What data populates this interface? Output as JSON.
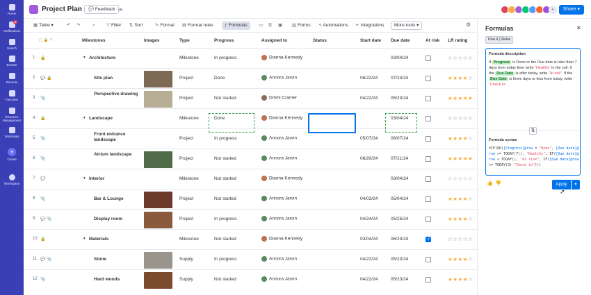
{
  "rail": [
    {
      "label": "Home",
      "icon": "home-icon"
    },
    {
      "label": "Notifications",
      "icon": "bell-icon",
      "badge": "5"
    },
    {
      "label": "Search",
      "icon": "search-icon"
    },
    {
      "label": "Browse",
      "icon": "folder-icon"
    },
    {
      "label": "Recents",
      "icon": "clock-icon"
    },
    {
      "label": "Favorites",
      "icon": "star-icon"
    },
    {
      "label": "Resource Management",
      "icon": "people-icon"
    },
    {
      "label": "WorkApps",
      "icon": "apps-icon"
    },
    {
      "label": "Create",
      "icon": "plus-icon",
      "glyph": "+"
    },
    {
      "label": "Workspace",
      "icon": "workspace-icon"
    }
  ],
  "header": {
    "title": "Project Plan",
    "feedback": "Feedback",
    "share": "Share",
    "avatars_more": "+",
    "avatar_colors": [
      "#e2445c",
      "#fdab3d",
      "#a25ddc",
      "#00c875",
      "#579bfc",
      "#ff642e",
      "#9d50dd"
    ]
  },
  "toolbar": {
    "table": "Table",
    "filter": "Filter",
    "sort": "Sort",
    "format": "Format",
    "format_rules": "Format rules",
    "formulas": "Formulas",
    "forms": "Forms",
    "automations": "Automations",
    "integrations": "Integrations",
    "more_tools": "More tools"
  },
  "columns": [
    "Milestones",
    "Images",
    "Type",
    "Progress",
    "Assigned to",
    "Status",
    "Start date",
    "Due date",
    "At risk",
    "LR rating"
  ],
  "rows": [
    {
      "num": "1",
      "name": "Architecture",
      "level": 0,
      "caret": "▾",
      "icons": "🔒",
      "image": false,
      "type": "Milestone",
      "progress": "In progress",
      "assignee": "Dianna Kennedy",
      "avatar": "#c0714f",
      "start": "",
      "due": "03/04/24",
      "risk": false,
      "rating": 0
    },
    {
      "num": "2",
      "name": "Site plan",
      "level": 1,
      "icons": "💬 🔒",
      "image": true,
      "img_color": "#7d6a55",
      "type": "Project",
      "progress": "Done",
      "assignee": "Annora Jarvin",
      "avatar": "#5b8a5e",
      "start": "06/22/24",
      "due": "07/23/24",
      "risk": false,
      "rating": 4
    },
    {
      "num": "3",
      "name": "Perspective drawing",
      "level": 1,
      "icons": "📎",
      "image": true,
      "img_color": "#b8ad95",
      "type": "Project",
      "progress": "Not started",
      "assignee": "Drishi Cramer",
      "avatar": "#8a6e5a",
      "start": "04/22/24",
      "due": "05/23/24",
      "risk": false,
      "rating": 5
    },
    {
      "num": "4",
      "name": "Landscape",
      "level": 0,
      "caret": "▾",
      "icons": "🔒",
      "image": false,
      "type": "Milestone",
      "progress": "Done",
      "assignee": "Dianna Kennedy",
      "avatar": "#c0714f",
      "start": "",
      "due": "03/04/24",
      "risk": false,
      "rating": 0
    },
    {
      "num": "5",
      "name": "Front entrance landscape",
      "level": 1,
      "icons": "📎",
      "image": false,
      "type": "Project",
      "progress": "In progress",
      "assignee": "Annora Jarvin",
      "avatar": "#5b8a5e",
      "start": "05/07/24",
      "due": "06/07/24",
      "risk": false,
      "rating": 4
    },
    {
      "num": "6",
      "name": "Atrium landscape",
      "level": 1,
      "icons": "📎",
      "image": true,
      "img_color": "#4f6b48",
      "type": "Project",
      "progress": "Not started",
      "assignee": "Annora Jarvin",
      "avatar": "#5b8a5e",
      "start": "06/20/24",
      "due": "07/21/24",
      "risk": false,
      "rating": 5
    },
    {
      "num": "7",
      "name": "Interior",
      "level": 0,
      "caret": "▾",
      "icons": "💬",
      "image": false,
      "type": "Milestone",
      "progress": "Not started",
      "assignee": "Dianna Kennedy",
      "avatar": "#c0714f",
      "start": "",
      "due": "03/04/24",
      "risk": false,
      "rating": 0
    },
    {
      "num": "8",
      "name": "Bar & Lounge",
      "level": 1,
      "icons": "📎",
      "image": true,
      "img_color": "#6b3a2a",
      "type": "Project",
      "progress": "Not started",
      "assignee": "Annora Jarvin",
      "avatar": "#5b8a5e",
      "start": "04/03/24",
      "due": "05/04/24",
      "risk": false,
      "rating": 4
    },
    {
      "num": "9",
      "name": "Display room",
      "level": 1,
      "icons": "💬 📎",
      "image": true,
      "img_color": "#8a5a3c",
      "type": "Project",
      "progress": "In progress",
      "assignee": "Annora Jarvin",
      "avatar": "#5b8a5e",
      "start": "04/24/24",
      "due": "05/25/24",
      "risk": false,
      "rating": 4
    },
    {
      "num": "10",
      "name": "Materials",
      "level": 0,
      "caret": "▾",
      "icons": "🔒",
      "image": false,
      "type": "Milestone",
      "progress": "Not started",
      "assignee": "Dianna Kennedy",
      "avatar": "#c0714f",
      "start": "03/04/24",
      "due": "06/23/24",
      "risk": true,
      "rating": 0
    },
    {
      "num": "11",
      "name": "Stone",
      "level": 1,
      "icons": "💬 📎",
      "image": true,
      "img_color": "#9a958c",
      "type": "Supply",
      "progress": "In progress",
      "assignee": "Annora Jarvin",
      "avatar": "#5b8a5e",
      "start": "04/22/24",
      "due": "05/23/24",
      "risk": false,
      "rating": 4
    },
    {
      "num": "12",
      "name": "Hard woods",
      "level": 1,
      "icons": "📎",
      "image": true,
      "img_color": "#7a4b2d",
      "type": "Supply",
      "progress": "Not started",
      "assignee": "Annora Jarvin",
      "avatar": "#5b8a5e",
      "start": "04/22/24",
      "due": "05/23/24",
      "risk": false,
      "rating": 4
    }
  ],
  "panel": {
    "title": "Formulas",
    "row_chip": "Row 4 | Status",
    "desc_label": "Formula description",
    "desc_parts": [
      {
        "t": "If ",
        "c": ""
      },
      {
        "t": "Progress",
        "c": "chip"
      },
      {
        "t": " is Done or the Due date is later than 7 days from today then write ",
        "c": ""
      },
      {
        "t": "\"Healthy\"",
        "c": "red"
      },
      {
        "t": " in the cell. If the ",
        "c": ""
      },
      {
        "t": "Due Date",
        "c": "chip"
      },
      {
        "t": " is after today, write ",
        "c": ""
      },
      {
        "t": "\"At risk\"",
        "c": "red"
      },
      {
        "t": ". If the ",
        "c": ""
      },
      {
        "t": "Due Date",
        "c": "chip"
      },
      {
        "t": " is three days or less from today, write ",
        "c": ""
      },
      {
        "t": "\"Check in\"",
        "c": "red"
      },
      {
        "t": ".",
        "c": ""
      }
    ],
    "syntax_label": "Formula syntax",
    "syntax_parts": [
      {
        "t": "=IF(OR(",
        "c": ""
      },
      {
        "t": "[Progress]@row",
        "c": "field"
      },
      {
        "t": " = ",
        "c": ""
      },
      {
        "t": "\"Done\"",
        "c": "str"
      },
      {
        "t": ", ",
        "c": ""
      },
      {
        "t": "[Due date]@row",
        "c": "field"
      },
      {
        "t": " >= TODAY(7)), ",
        "c": ""
      },
      {
        "t": "\"Healthy\"",
        "c": "str"
      },
      {
        "t": ", IF(",
        "c": ""
      },
      {
        "t": "[Due date]@row",
        "c": "field"
      },
      {
        "t": " < TODAY(), ",
        "c": ""
      },
      {
        "t": "\"At risk\"",
        "c": "str"
      },
      {
        "t": ", IF(",
        "c": ""
      },
      {
        "t": "[Due date]@row",
        "c": "field"
      },
      {
        "t": " <= TODAY(3) ",
        "c": ""
      },
      {
        "t": "\"Check in\"",
        "c": "str"
      },
      {
        "t": ")))",
        "c": ""
      }
    ],
    "apply": "Apply"
  }
}
